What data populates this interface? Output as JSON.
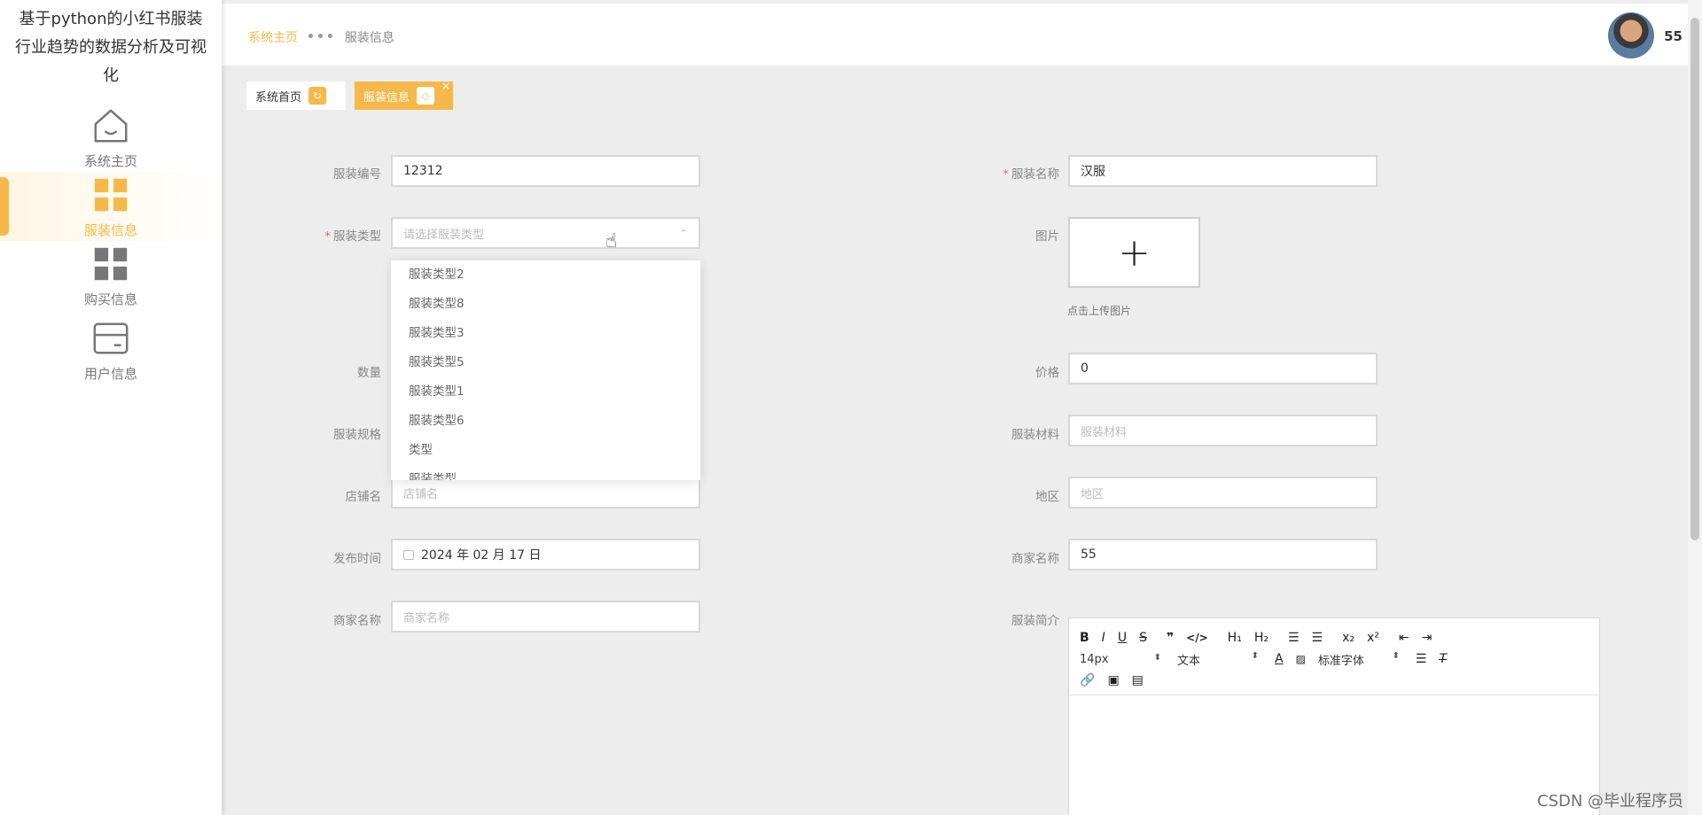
{
  "sidebar": {
    "title": "基于python的小红书服装行业趋势的数据分析及可视化",
    "items": [
      {
        "label": "系统主页",
        "icon": "home-icon"
      },
      {
        "label": "服装信息",
        "icon": "grid-icon",
        "active": true
      },
      {
        "label": "购买信息",
        "icon": "grid-icon"
      },
      {
        "label": "用户信息",
        "icon": "card-icon"
      }
    ]
  },
  "header": {
    "breadcrumb": {
      "home": "系统主页",
      "current": "服装信息"
    },
    "username": "55"
  },
  "tabs": [
    {
      "label": "系统首页"
    },
    {
      "label": "服装信息",
      "active": true
    }
  ],
  "form": {
    "code": {
      "label": "服装编号",
      "value": "12312"
    },
    "name": {
      "label": "服装名称",
      "value": "汉服"
    },
    "type": {
      "label": "服装类型",
      "placeholder": "请选择服装类型"
    },
    "image": {
      "label": "图片",
      "hint": "点击上传图片"
    },
    "quantity": {
      "label": "数量"
    },
    "price": {
      "label": "价格",
      "value": "0"
    },
    "spec": {
      "label": "服装规格"
    },
    "material": {
      "label": "服装材料",
      "placeholder": "服装材料"
    },
    "shop": {
      "label": "店铺名",
      "placeholder": "店铺名"
    },
    "region": {
      "label": "地区",
      "placeholder": "地区"
    },
    "publish_time": {
      "label": "发布时间",
      "value": "2024 年 02 月 17 日"
    },
    "merchant_right": {
      "label": "商家名称",
      "value": "55"
    },
    "merchant_left": {
      "label": "商家名称",
      "placeholder": "商家名称"
    },
    "intro": {
      "label": "服装简介"
    }
  },
  "dropdown_options": [
    "服装类型2",
    "服装类型8",
    "服装类型3",
    "服装类型5",
    "服装类型1",
    "服装类型6",
    "类型",
    "服装类型"
  ],
  "editor": {
    "font_size": "14px",
    "paragraph": "文本",
    "font_family": "标准字体"
  },
  "watermark": "CSDN @毕业程序员",
  "colors": {
    "accent": "#f7b84a",
    "required": "#f56c6c"
  }
}
